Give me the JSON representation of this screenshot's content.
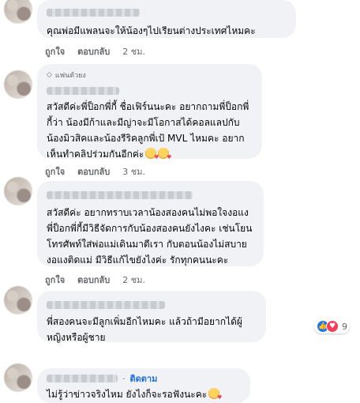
{
  "comments": [
    {
      "text": "คุณพ่อมีแพลนจะให้น้องๆไปเรียนต่างประเทศไหมคะ",
      "like": "ถูกใจ",
      "reply": "ตอบกลับ",
      "time": "2 ชม."
    },
    {
      "badge": "แฟนตัวยง",
      "text": "สวัสดีค่ะพี่ป็อกพี่กี้ ชื่อเฟิร์นนะคะ อยากถามพี่ป็อกพี่กี้ว่า น้องมีก้าและมีญ่าจะมีโอกาสได้คอลแลปกับน้องมิวสิคและน้องรีริคลูกพี่เป้ MVL ไหมคะ อยากเห็นทำคลิปร่วมกันอีกค่ะ",
      "emoji": "smiling-face-with-hearts",
      "like": "ถูกใจ",
      "reply": "ตอบกลับ",
      "time": "3 ชม."
    },
    {
      "text": "สวัสดีค่ะ อยากทราบเวลาน้องสองคนไม่พอใจงอแง พี่ป็อกพี่กี้มีวิธีจัดการกับน้องสองคนยังไงคะ เช่นโยนโทรศัพท์ใส่พ่อแม่เดินมาตีเรา กับตอนน้องไม่สบายงอแงติดแม่ มีวิธีแก้ไขยังไงค่ะ รักทุกคนนะคะ",
      "like": "ถูกใจ",
      "reply": "ตอบกลับ",
      "time": "2 ชม."
    },
    {
      "text": "พี่สองคนจะมีลูกเพิ่มอีกไหมคะ แล้วถ้ามีอยากได้ผู้หญิงหรือผู้ชาย",
      "reactions_count": "9",
      "like": "ถูกใจ",
      "reply": "ตอบกลับ",
      "time": "3 ชม."
    },
    {
      "follow": "ติดตาม",
      "separator": "·",
      "text": "ไม่รู้ว่าข่าวจริงไหม ยังไงก็จะรอฟังนะคะ",
      "emoji": "smiling-face-with-hearts"
    }
  ]
}
